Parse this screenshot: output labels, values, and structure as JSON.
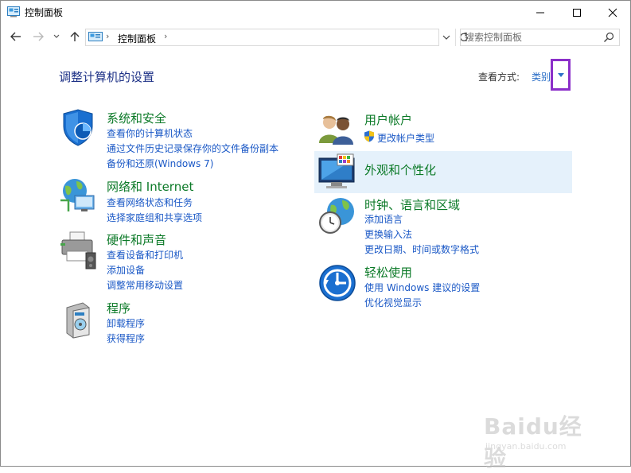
{
  "window": {
    "title": "控制面板"
  },
  "address": {
    "crumb": "控制面板"
  },
  "search": {
    "placeholder": "搜索控制面板"
  },
  "header": {
    "title": "调整计算机的设置",
    "view_by_label": "查看方式:",
    "view_by_value": "类别"
  },
  "categories_left": [
    {
      "title": "系统和安全",
      "links": [
        "查看你的计算机状态",
        "通过文件历史记录保存你的文件备份副本",
        "备份和还原(Windows 7)"
      ]
    },
    {
      "title": "网络和 Internet",
      "links": [
        "查看网络状态和任务",
        "选择家庭组和共享选项"
      ]
    },
    {
      "title": "硬件和声音",
      "links": [
        "查看设备和打印机",
        "添加设备",
        "调整常用移动设置"
      ]
    },
    {
      "title": "程序",
      "links": [
        "卸载程序",
        "获得程序"
      ]
    }
  ],
  "categories_right": [
    {
      "title": "用户帐户",
      "links": [
        "更改帐户类型"
      ]
    },
    {
      "title": "外观和个性化",
      "links": []
    },
    {
      "title": "时钟、语言和区域",
      "links": [
        "添加语言",
        "更换输入法",
        "更改日期、时间或数字格式"
      ]
    },
    {
      "title": "轻松使用",
      "links": [
        "使用 Windows 建议的设置",
        "优化视觉显示"
      ]
    }
  ],
  "watermark": {
    "brand": "Baidu经验",
    "url": "jingyan.baidu.com"
  },
  "colors": {
    "link": "#1a58c6",
    "category_title": "#0c7a28",
    "page_title": "#1e3287",
    "highlight": "#e5f1fb",
    "annotation_box": "#8b2fc9"
  }
}
